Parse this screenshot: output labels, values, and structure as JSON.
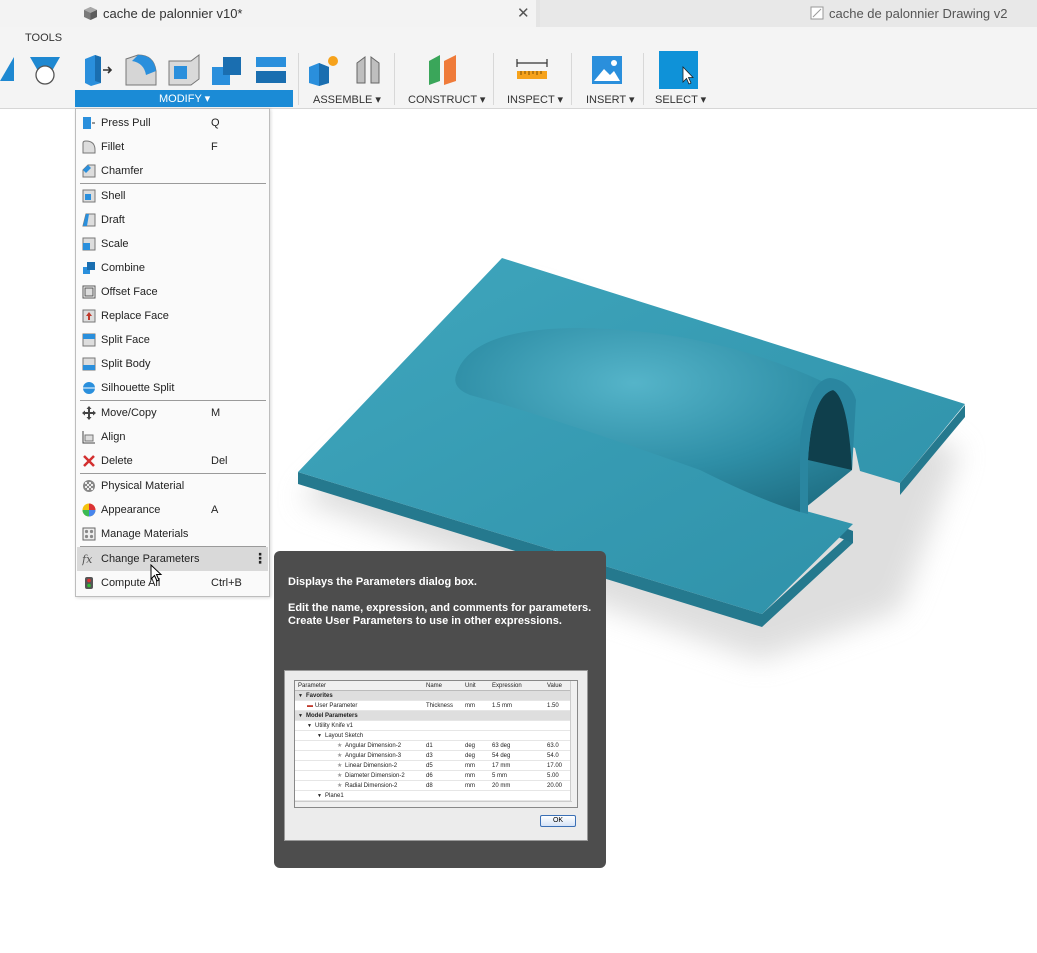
{
  "tabs": [
    {
      "title": "cache de palonnier v10*",
      "active": true,
      "close": "✕"
    },
    {
      "title": "cache de palonnier Drawing v2",
      "active": false
    }
  ],
  "toolbar": {
    "tools_label": "TOOLS",
    "groups": {
      "modify": "MODIFY ▾",
      "assemble": "ASSEMBLE ▾",
      "construct": "CONSTRUCT ▾",
      "inspect": "INSPECT ▾",
      "insert": "INSERT ▾",
      "select": "SELECT ▾"
    }
  },
  "menu": {
    "items": [
      {
        "label": "Press Pull",
        "key": "Q",
        "icon": "press-pull-icon"
      },
      {
        "label": "Fillet",
        "key": "F",
        "icon": "fillet-icon"
      },
      {
        "label": "Chamfer",
        "key": "",
        "icon": "chamfer-icon"
      },
      {
        "label": "Shell",
        "key": "",
        "icon": "shell-icon"
      },
      {
        "label": "Draft",
        "key": "",
        "icon": "draft-icon"
      },
      {
        "label": "Scale",
        "key": "",
        "icon": "scale-icon"
      },
      {
        "label": "Combine",
        "key": "",
        "icon": "combine-icon"
      },
      {
        "label": "Offset Face",
        "key": "",
        "icon": "offset-face-icon"
      },
      {
        "label": "Replace Face",
        "key": "",
        "icon": "replace-face-icon"
      },
      {
        "label": "Split Face",
        "key": "",
        "icon": "split-face-icon"
      },
      {
        "label": "Split Body",
        "key": "",
        "icon": "split-body-icon"
      },
      {
        "label": "Silhouette Split",
        "key": "",
        "icon": "silhouette-split-icon"
      },
      {
        "label": "Move/Copy",
        "key": "M",
        "icon": "move-icon"
      },
      {
        "label": "Align",
        "key": "",
        "icon": "align-icon"
      },
      {
        "label": "Delete",
        "key": "Del",
        "icon": "delete-icon"
      },
      {
        "label": "Physical Material",
        "key": "",
        "icon": "physical-material-icon"
      },
      {
        "label": "Appearance",
        "key": "A",
        "icon": "appearance-icon"
      },
      {
        "label": "Manage Materials",
        "key": "",
        "icon": "manage-materials-icon"
      },
      {
        "label": "Change Parameters",
        "key": "",
        "icon": "fx-icon"
      },
      {
        "label": "Compute All",
        "key": "Ctrl+B",
        "icon": "compute-all-icon"
      }
    ],
    "more_glyph": "⋮"
  },
  "tooltip": {
    "title": "Displays the Parameters dialog box.",
    "body": "Edit the name, expression, and comments for parameters. Create User Parameters to use in other expressions.",
    "preview": {
      "headers": [
        "Parameter",
        "Name",
        "Unit",
        "Expression",
        "Value"
      ],
      "rows": [
        {
          "param": "Favorites",
          "name": "",
          "unit": "",
          "expr": "",
          "value": "",
          "level": 0,
          "group": true
        },
        {
          "param": "User Parameter",
          "name": "Thickness",
          "unit": "mm",
          "expr": "1.5 mm",
          "value": "1.50",
          "level": 1,
          "group": false
        },
        {
          "param": "Model Parameters",
          "name": "",
          "unit": "",
          "expr": "",
          "value": "",
          "level": 0,
          "group": true
        },
        {
          "param": "Utility Knife v1",
          "name": "",
          "unit": "",
          "expr": "",
          "value": "",
          "level": 1,
          "group": false
        },
        {
          "param": "Layout Sketch",
          "name": "",
          "unit": "",
          "expr": "",
          "value": "",
          "level": 2,
          "group": false
        },
        {
          "param": "Angular Dimension-2",
          "name": "d1",
          "unit": "deg",
          "expr": "63 deg",
          "value": "63.0",
          "level": 3,
          "group": false
        },
        {
          "param": "Angular Dimension-3",
          "name": "d3",
          "unit": "deg",
          "expr": "54 deg",
          "value": "54.0",
          "level": 3,
          "group": false
        },
        {
          "param": "Linear Dimension-2",
          "name": "d5",
          "unit": "mm",
          "expr": "17 mm",
          "value": "17.00",
          "level": 3,
          "group": false
        },
        {
          "param": "Diameter Dimension-2",
          "name": "d6",
          "unit": "mm",
          "expr": "5 mm",
          "value": "5.00",
          "level": 3,
          "group": false
        },
        {
          "param": "Radial Dimension-2",
          "name": "d8",
          "unit": "mm",
          "expr": "20 mm",
          "value": "20.00",
          "level": 3,
          "group": false
        },
        {
          "param": "Plane1",
          "name": "",
          "unit": "",
          "expr": "",
          "value": "",
          "level": 2,
          "group": false
        }
      ],
      "ok_label": "OK"
    }
  },
  "colors": {
    "accent": "#1b8bd6",
    "model": "#2e93ab",
    "tooltip_bg": "#4d4d4d"
  }
}
